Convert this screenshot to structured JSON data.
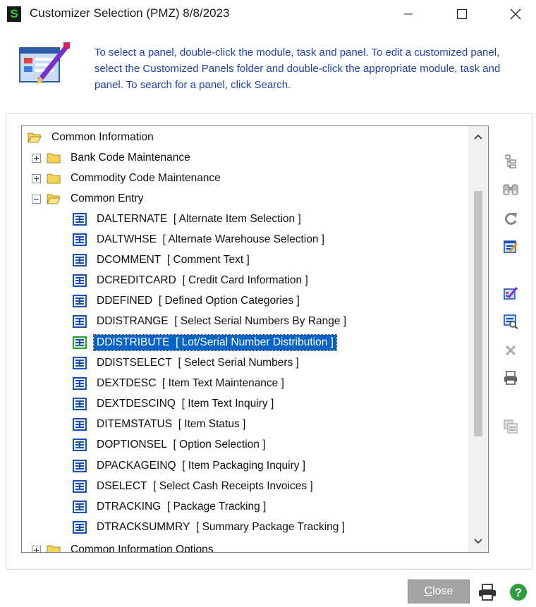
{
  "window": {
    "title": "Customizer Selection (PMZ) 8/8/2023",
    "app_icon_letter": "S",
    "controls": {
      "minimize": "minimize-icon",
      "maximize": "maximize-icon",
      "close": "close-icon"
    }
  },
  "banner": {
    "icon": "customizer-panel-icon",
    "text": "To select a panel, double-click the module, task and panel. To edit a customized panel, select the Customized Panels folder and double-click the appropriate module, task and panel. To search for a panel, click Search."
  },
  "tree": {
    "root": {
      "label": "Common Information",
      "expanded": true
    },
    "folders": [
      {
        "label": "Bank Code Maintenance",
        "expanded": false
      },
      {
        "label": "Commodity Code Maintenance",
        "expanded": false
      },
      {
        "label": "Common Entry",
        "expanded": true
      }
    ],
    "panels": [
      {
        "name": "DALTERNATE",
        "desc": "[ Alternate Item Selection ]"
      },
      {
        "name": "DALTWHSE",
        "desc": "[ Alternate Warehouse Selection ]"
      },
      {
        "name": "DCOMMENT",
        "desc": "[ Comment Text ]"
      },
      {
        "name": "DCREDITCARD",
        "desc": "[ Credit Card Information ]"
      },
      {
        "name": "DDEFINED",
        "desc": "[ Defined Option Categories ]"
      },
      {
        "name": "DDISTRANGE",
        "desc": "[ Select Serial Numbers By Range ]"
      },
      {
        "name": "DDISTRIBUTE",
        "desc": "[ Lot/Serial Number Distribution ]"
      },
      {
        "name": "DDISTSELECT",
        "desc": "[ Select Serial Numbers ]"
      },
      {
        "name": "DEXTDESC",
        "desc": "[ Item Text Maintenance ]"
      },
      {
        "name": "DEXTDESCINQ",
        "desc": "[ Item Text Inquiry ]"
      },
      {
        "name": "DITEMSTATUS",
        "desc": "[ Item Status ]"
      },
      {
        "name": "DOPTIONSEL",
        "desc": "[ Option Selection ]"
      },
      {
        "name": "DPACKAGEINQ",
        "desc": "[ Item Packaging Inquiry ]"
      },
      {
        "name": "DSELECT",
        "desc": "[ Select Cash Receipts Invoices ]"
      },
      {
        "name": "DTRACKING",
        "desc": "[ Package Tracking ]"
      },
      {
        "name": "DTRACKSUMMRY",
        "desc": "[ Summary Package Tracking ]"
      }
    ],
    "selected_panel": "DDISTRIBUTE",
    "partial_next_folder": "Common Information Options"
  },
  "toolbar_icons": [
    "tree-view-icon",
    "search-binoculars-icon",
    "refresh-icon",
    "edit-panel-icon",
    "customize-panel-icon",
    "preview-panel-icon",
    "delete-icon",
    "print-icon",
    "copy-panel-icon"
  ],
  "footer": {
    "close_label_underlined": "C",
    "close_label_rest": "lose",
    "print_icon": "printer-icon",
    "help_icon": "help-icon"
  },
  "colors": {
    "banner_text": "#1f3fb5",
    "selection": "#0a64c8",
    "folder": "#f5d25a"
  }
}
